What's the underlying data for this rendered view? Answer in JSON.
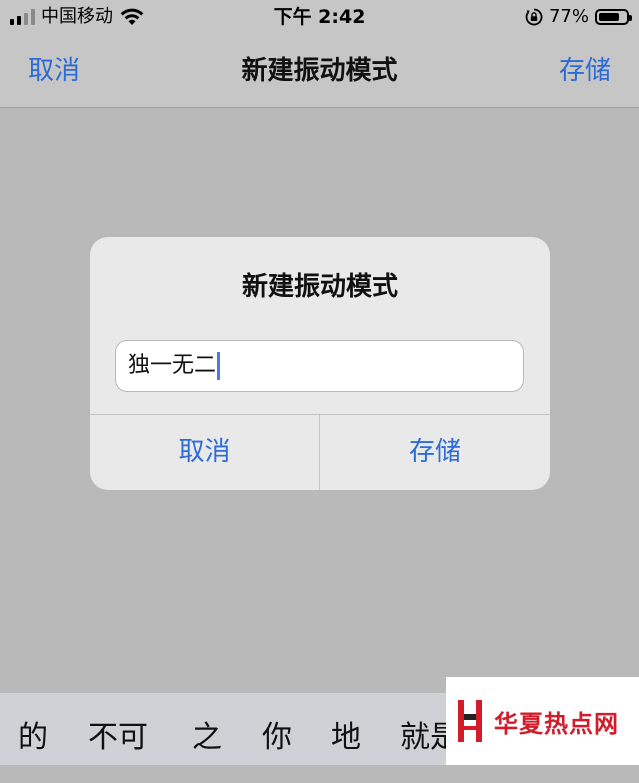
{
  "status_bar": {
    "carrier": "中国移动",
    "time": "下午 2:42",
    "battery_percent": "77%",
    "battery_level": 0.77,
    "signal_bars": 4,
    "signal_active": 2
  },
  "nav": {
    "cancel_label": "取消",
    "title": "新建振动模式",
    "save_label": "存储"
  },
  "alert": {
    "title": "新建振动模式",
    "input_value": "独一无二",
    "cancel_label": "取消",
    "save_label": "存储"
  },
  "candidates": [
    "的",
    "不可",
    "之",
    "你",
    "地",
    "就是"
  ],
  "watermark": {
    "text": "华夏热点网"
  },
  "colors": {
    "accent": "#2d6bd6",
    "watermark_red": "#d21c2b"
  }
}
